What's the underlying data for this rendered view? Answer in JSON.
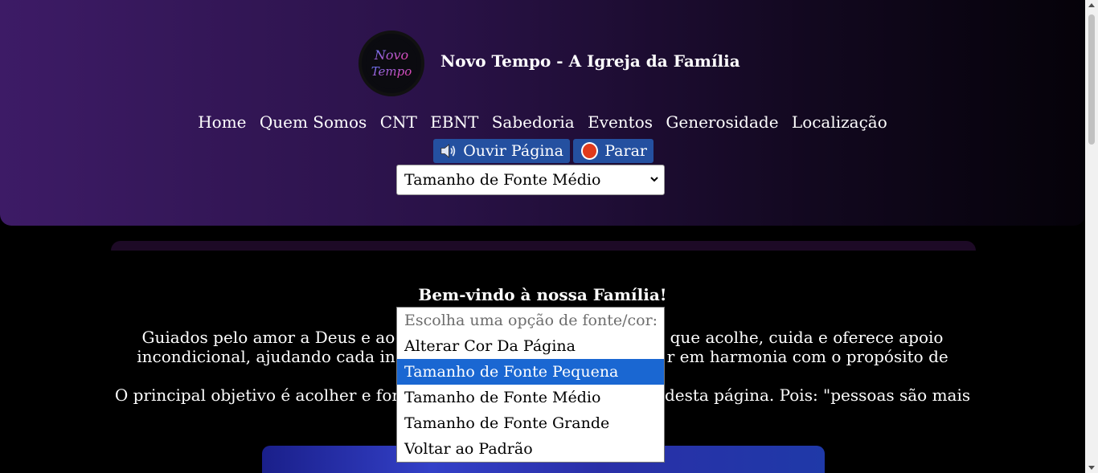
{
  "site": {
    "title": "Novo Tempo - A Igreja da Família",
    "logo_text_line1": "Novo",
    "logo_text_line2": "Tempo"
  },
  "nav": {
    "items": [
      "Home",
      "Quem Somos",
      "CNT",
      "EBNT",
      "Sabedoria",
      "Eventos",
      "Generosidade",
      "Localização"
    ]
  },
  "audio": {
    "play_label": "Ouvir Página",
    "stop_label": "Parar",
    "play_icon": "speaker-icon",
    "stop_icon": "stop-sign-icon"
  },
  "font_select": {
    "selected_value": "Tamanho de Fonte Médio",
    "options": [
      "Escolha uma opção de fonte/cor:",
      "Alterar Cor Da Página",
      "Tamanho de Fonte Pequena",
      "Tamanho de Fonte Médio",
      "Tamanho de Fonte Grande",
      "Voltar ao Padrão"
    ],
    "highlighted_option": "Tamanho de Fonte Pequena"
  },
  "main": {
    "welcome": "Bem-vindo à nossa Família!",
    "para1_left": "Guiados pelo amor a Deus e ao",
    "para1_right": "a que acolhe, cuida e oferece apoio",
    "para2_left": "incondicional, ajudando cada in",
    "para2_right": "r em harmonia com o propósito de",
    "para3_left": "O principal objetivo é acolher e for",
    "para3_right": "desta página. Pois: \"pessoas são mais"
  },
  "colors": {
    "header_gradient_start": "#3d1b66",
    "button_bg": "#2450a0",
    "option_highlight": "#1a67d2",
    "page_bg": "#000000"
  }
}
